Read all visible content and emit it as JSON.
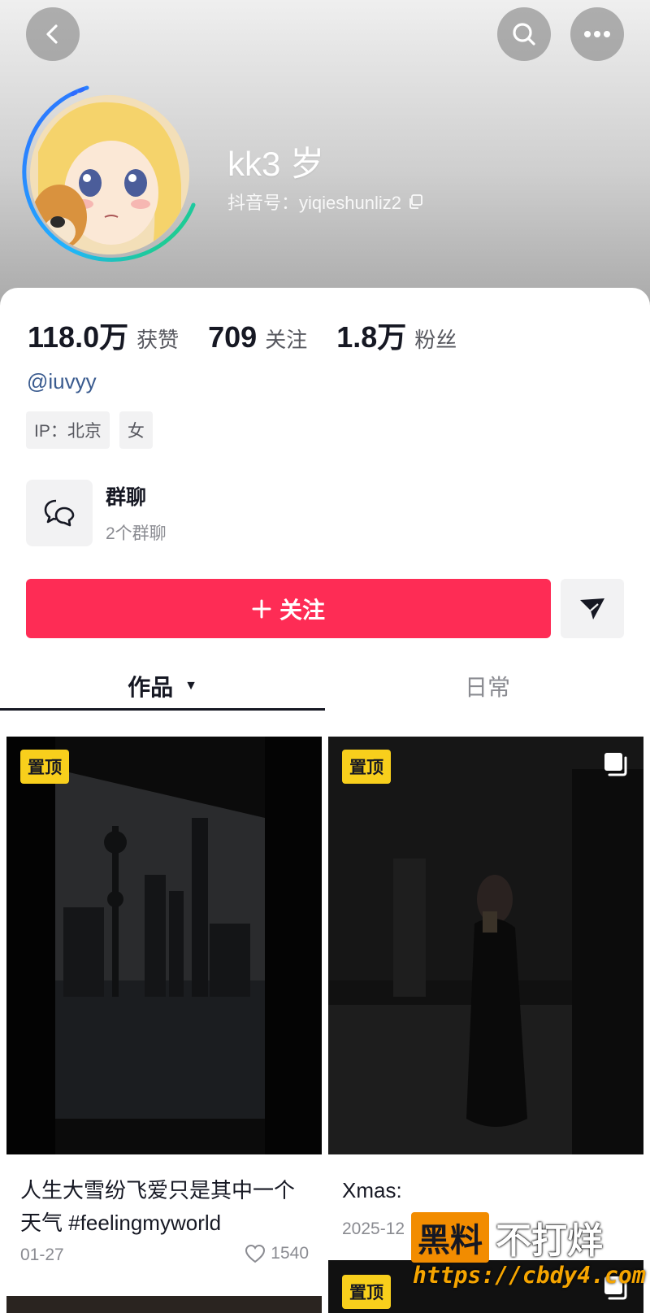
{
  "header": {
    "nickname": "kk3 岁",
    "douyin_id": "抖音号：yiqieshunliz2"
  },
  "stats": [
    {
      "value": "118.0万",
      "label": "获赞"
    },
    {
      "value": "709",
      "label": "关注"
    },
    {
      "value": "1.8万",
      "label": "粉丝"
    }
  ],
  "profile": {
    "handle": "@iuvyy",
    "tags": [
      "IP：北京",
      "女"
    ]
  },
  "group_chat": {
    "title": "群聊",
    "subtitle": "2个群聊"
  },
  "actions": {
    "follow_label": "关注"
  },
  "tabs": [
    {
      "label": "作品",
      "active": true
    },
    {
      "label": "日常",
      "active": false
    }
  ],
  "posts": [
    {
      "badge": "置顶",
      "title": "人生大雪纷飞爱只是其中一个天气 #feelingmyworld",
      "date": "01-27",
      "likes": "1540"
    },
    {
      "badge": "置顶",
      "title": "Xmas:",
      "date": "2025-12"
    },
    {
      "badge": "置顶"
    }
  ],
  "watermark": {
    "chip": "黑料",
    "text": "不打烊",
    "url": "https://cbdy4.com"
  },
  "colors": {
    "accent": "#fe2c55",
    "pin": "#f8cf1c",
    "handle": "#3a5b8f"
  }
}
